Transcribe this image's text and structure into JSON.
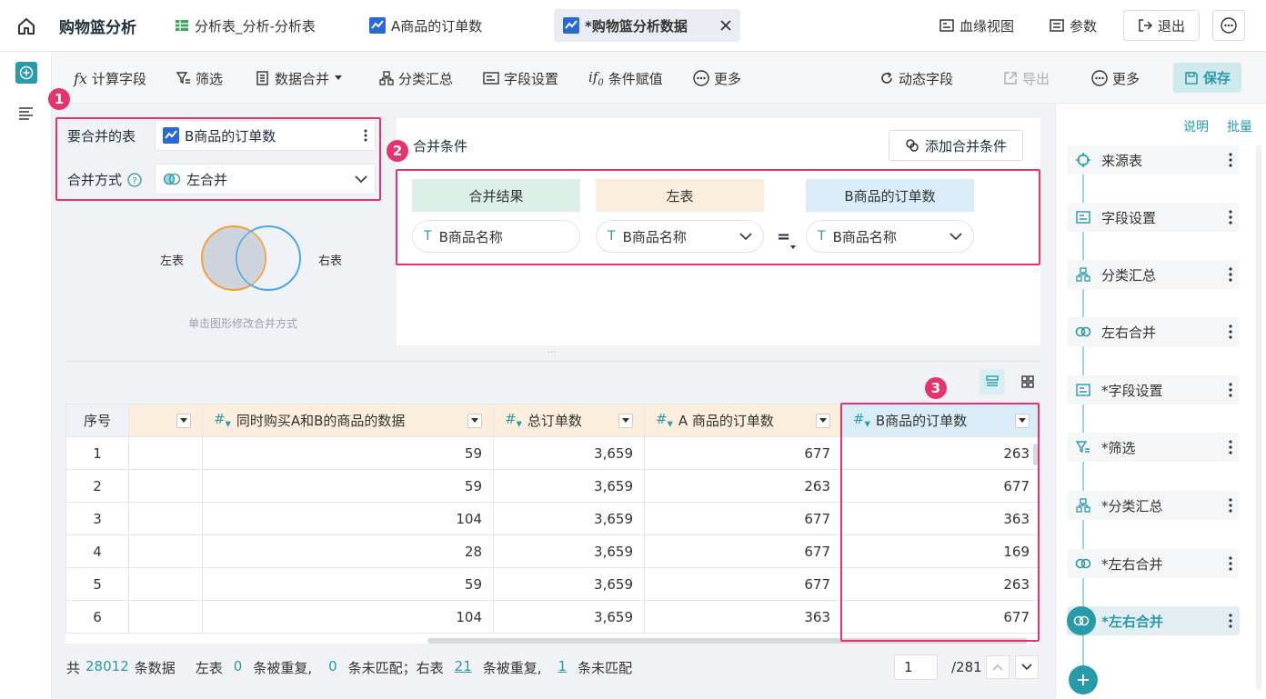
{
  "app_title": "购物篮分析",
  "tabs": [
    {
      "label": "分析表_分析-分析表"
    },
    {
      "label": "A商品的订单数"
    },
    {
      "label": "*购物篮分析数据"
    }
  ],
  "header": {
    "lineage": "血缘视图",
    "params": "参数",
    "exit": "退出"
  },
  "toolbar": {
    "calc_field": "计算字段",
    "filter": "筛选",
    "merge": "数据合并",
    "group": "分类汇总",
    "field_settings": "字段设置",
    "conditional": "条件赋值",
    "more": "更多",
    "dynamic_field": "动态字段",
    "export": "导出",
    "more2": "更多",
    "save": "保存"
  },
  "merge_config": {
    "table_label": "要合并的表",
    "table_value": "B商品的订单数",
    "method_label": "合并方式",
    "method_value": "左合并",
    "venn_left": "左表",
    "venn_right": "右表",
    "venn_hint": "单击图形修改合并方式"
  },
  "merge_conditions": {
    "title": "合并条件",
    "add_button": "添加合并条件",
    "headers": {
      "result": "合并结果",
      "left": "左表",
      "right": "B商品的订单数"
    },
    "result_field": "B商品名称",
    "left_field": "B商品名称",
    "operator": "=",
    "right_field": "B商品名称"
  },
  "badges": {
    "one": "1",
    "two": "2",
    "three": "3"
  },
  "table": {
    "columns": [
      "序号",
      "",
      "同时购买A和B的商品的数据",
      "总订单数",
      "A 商品的订单数",
      "B商品的订单数"
    ],
    "rows": [
      {
        "idx": "1",
        "c1": "",
        "c2": "59",
        "c3": "3,659",
        "c4": "677",
        "c5": "263"
      },
      {
        "idx": "2",
        "c1": "",
        "c2": "59",
        "c3": "3,659",
        "c4": "263",
        "c5": "677"
      },
      {
        "idx": "3",
        "c1": "",
        "c2": "104",
        "c3": "3,659",
        "c4": "677",
        "c5": "363"
      },
      {
        "idx": "4",
        "c1": "",
        "c2": "28",
        "c3": "3,659",
        "c4": "677",
        "c5": "169"
      },
      {
        "idx": "5",
        "c1": "",
        "c2": "59",
        "c3": "3,659",
        "c4": "677",
        "c5": "263"
      },
      {
        "idx": "6",
        "c1": "",
        "c2": "104",
        "c3": "3,659",
        "c4": "363",
        "c5": "677"
      }
    ]
  },
  "footer": {
    "total_prefix": "共",
    "total": "28012",
    "total_suffix": "条数据",
    "left_label": "左表",
    "left_dup": "0",
    "dup_text": "条被重复,",
    "left_unmatched": "0",
    "unmatched_text": "条未匹配；右表",
    "right_dup": "21",
    "dup_text2": "条被重复,",
    "right_unmatched": "1",
    "unmatched_text2": "条未匹配",
    "page": "1",
    "page_total": "/281"
  },
  "right_panel": {
    "desc": "说明",
    "batch": "批量",
    "steps": [
      {
        "label": "来源表",
        "icon": "source-table-icon"
      },
      {
        "label": "字段设置",
        "icon": "field-settings-icon"
      },
      {
        "label": "分类汇总",
        "icon": "group-summary-icon"
      },
      {
        "label": "左右合并",
        "icon": "merge-icon"
      },
      {
        "label": "*字段设置",
        "icon": "field-settings-icon"
      },
      {
        "label": "*筛选",
        "icon": "filter-icon"
      },
      {
        "label": "*分类汇总",
        "icon": "group-summary-icon"
      },
      {
        "label": "*左右合并",
        "icon": "merge-icon"
      },
      {
        "label": "*左右合并",
        "icon": "merge-icon"
      }
    ]
  },
  "colors": {
    "accent": "#2a9aa8",
    "highlight": "#e5336e",
    "left_header": "#fbeedd",
    "right_header": "#d9ecf8",
    "result_header": "#dcefe6"
  }
}
